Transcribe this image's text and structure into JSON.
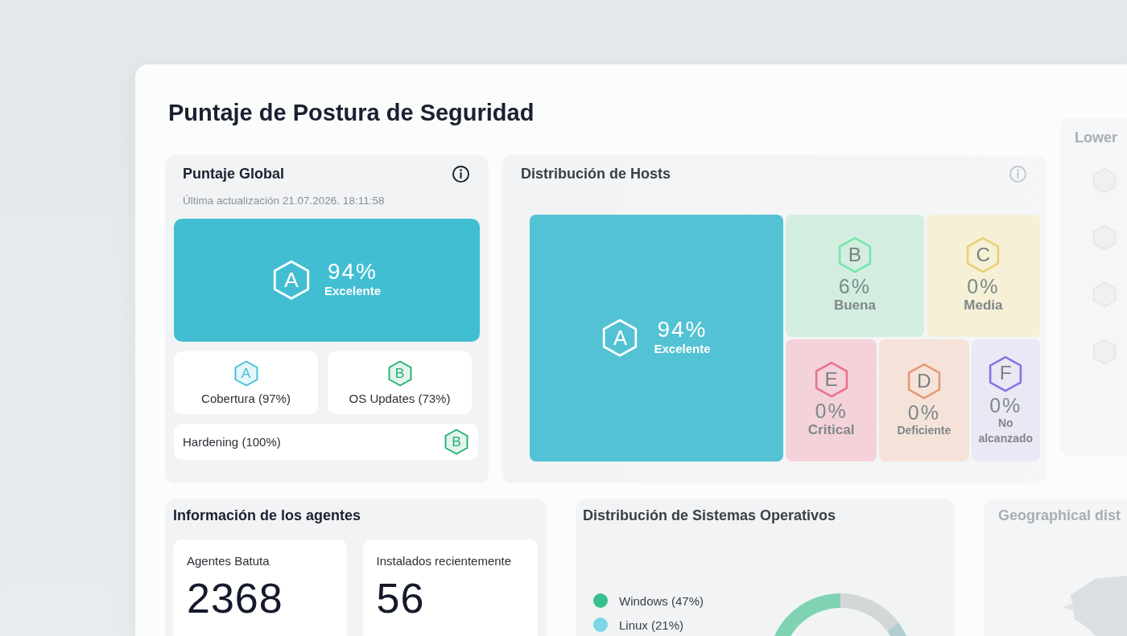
{
  "page": {
    "title": "Puntaje de Postura de Seguridad"
  },
  "global_score": {
    "title": "Puntaje Global",
    "updated": "Última actualización 21.07.2026. 18:11:58",
    "overall": {
      "grade": "A",
      "percent": "94%",
      "label": "Excelente"
    },
    "metrics": [
      {
        "kind": "tile",
        "grade": "A",
        "label": "Cobertura (97%)",
        "color": "#3fbfd6"
      },
      {
        "kind": "tile",
        "grade": "B",
        "label": "OS Updates (73%)",
        "color": "#22b070"
      },
      {
        "kind": "row",
        "grade": "B",
        "label": "Hardening (100%)",
        "color": "#22b070"
      }
    ]
  },
  "host_distribution": {
    "title": "Distribución de Hosts",
    "tiles": [
      {
        "kind": "main",
        "grade": "A",
        "percent": "94%",
        "label": "Excelente",
        "color": "#52c2d4"
      },
      {
        "kind": "minor",
        "grade": "B",
        "percent": "6%",
        "label": "Buena",
        "color": "#d3eee0"
      },
      {
        "kind": "minor",
        "grade": "C",
        "percent": "0%",
        "label": "Media",
        "color": "#f6f0d6"
      },
      {
        "kind": "minor",
        "grade": "E",
        "percent": "0%",
        "label": "Critical",
        "color": "#f4d2d9"
      },
      {
        "kind": "minor",
        "grade": "D",
        "percent": "0%",
        "label": "Deficiente",
        "color": "#f5e3da"
      },
      {
        "kind": "minor",
        "grade": "F",
        "percent": "0%",
        "label": "No alcanzado",
        "color": "#eae8f4"
      }
    ]
  },
  "side_panel": {
    "title": "Lower"
  },
  "agents": {
    "title": "Información de los agentes",
    "stats": [
      {
        "label": "Agentes Batuta",
        "value": "2368"
      },
      {
        "label": "Instalados recientemente",
        "value": "56"
      }
    ]
  },
  "os_distribution": {
    "title": "Distribución de Sistemas Operativos",
    "legend": [
      {
        "label": "Windows (47%)",
        "color": "#35c08c"
      },
      {
        "label": "Linux (21%)",
        "color": "#7dd6e6"
      }
    ]
  },
  "geo": {
    "title": "Geographical dist"
  }
}
